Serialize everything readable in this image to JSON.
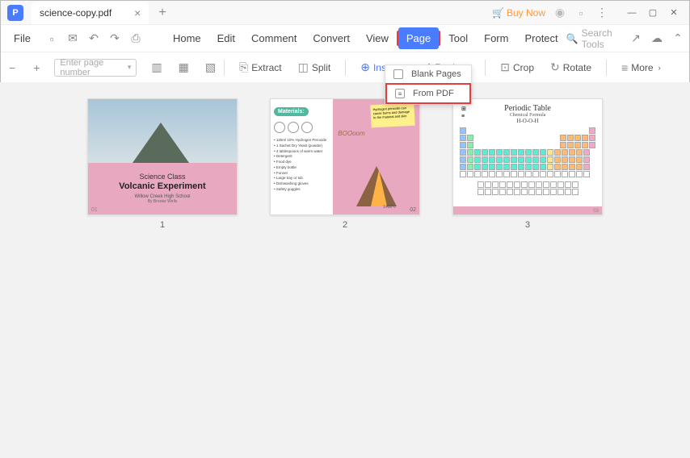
{
  "app": {
    "tab_title": "science-copy.pdf"
  },
  "titlebar": {
    "buy_now": "Buy Now"
  },
  "menubar": {
    "file": "File",
    "items": [
      "Home",
      "Edit",
      "Comment",
      "Convert",
      "View",
      "Page",
      "Tool",
      "Form",
      "Protect"
    ],
    "search_placeholder": "Search Tools"
  },
  "toolbar": {
    "page_input_placeholder": "Enter page number",
    "extract": "Extract",
    "split": "Split",
    "insert": "Insert",
    "replace": "Replace",
    "crop": "Crop",
    "rotate": "Rotate",
    "more": "More"
  },
  "dropdown": {
    "blank_pages": "Blank Pages",
    "from_pdf": "From PDF"
  },
  "pages": {
    "p1": {
      "num": "1",
      "title": "Science Class",
      "subtitle": "Volcanic Experiment",
      "school": "Willow Creek High School",
      "author": "By Brooke Wells",
      "corner": "01"
    },
    "p2": {
      "num": "2",
      "materials_label": "Materials:",
      "list": "• 125ml 10% Hydrogen Peroxide\n• 1 Sachet Dry Yeast (powder)\n• 4 tablespoons of warm water\n• Detergent\n• Food dye\n• Empty bottle\n• Funnel\n• Large tray or tub\n• Dishwashing gloves\n• Safety goggles",
      "boom": "BOOoom",
      "temp": "1400°c",
      "corner": "02"
    },
    "p3": {
      "num": "3",
      "title": "Periodic Table",
      "sub": "Chemical Formula",
      "formula": "H-O-O-H",
      "corner": "03"
    }
  }
}
